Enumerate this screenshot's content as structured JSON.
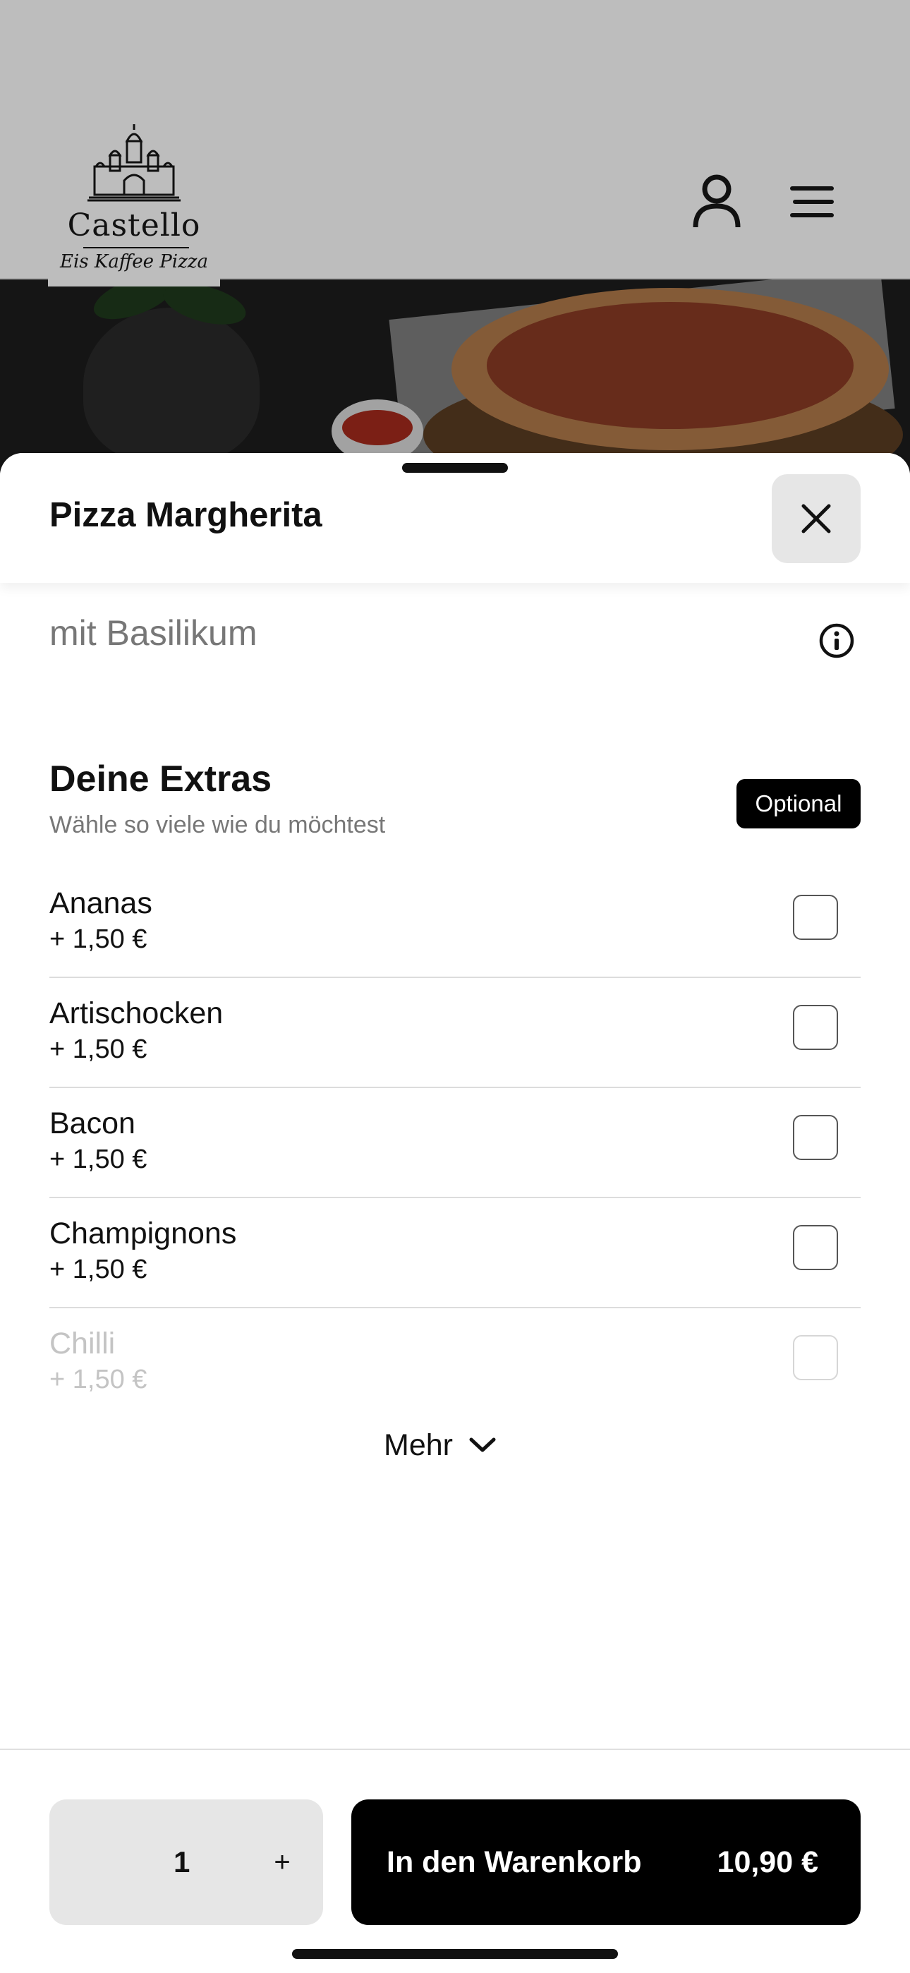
{
  "header": {
    "logo_name": "Castello",
    "logo_tagline": "Eis Kaffee Pizza",
    "user_icon": "user-icon",
    "menu_icon": "hamburger-menu-icon"
  },
  "sheet": {
    "title": "Pizza Margherita",
    "close_icon": "close-icon",
    "description": "mit Basilikum",
    "info_icon": "info-icon"
  },
  "extras": {
    "title": "Deine Extras",
    "subtitle": "Wähle so viele wie du möchtest",
    "badge": "Optional",
    "items": [
      {
        "name": "Ananas",
        "price": "+ 1,50 €"
      },
      {
        "name": "Artischocken",
        "price": "+ 1,50 €"
      },
      {
        "name": "Bacon",
        "price": "+ 1,50 €"
      },
      {
        "name": "Champignons",
        "price": "+ 1,50 €"
      },
      {
        "name": "Chilli",
        "price": "+ 1,50 €"
      }
    ],
    "more_label": "Mehr",
    "more_icon": "chevron-down-icon"
  },
  "footer": {
    "quantity": "1",
    "plus_label": "+",
    "cart_label": "In den Warenkorb",
    "cart_price": "10,90 €"
  },
  "colors": {
    "overlay": "#bdbdbd",
    "primary": "#000000",
    "muted_text": "#777777"
  }
}
